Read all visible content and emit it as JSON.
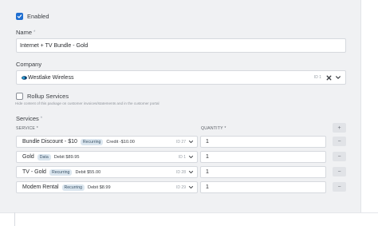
{
  "enabled": {
    "label": "Enabled",
    "checked": true
  },
  "name": {
    "label": "Name",
    "required_mark": "*",
    "value": "Internet + TV Bundle - Gold"
  },
  "company": {
    "label": "Company",
    "value": "Westlake Wireless",
    "id_text": "ID 1"
  },
  "rollup": {
    "label": "Rollup Services",
    "checked": false,
    "help": "Hide content of this package on customer invoices/statements and in the customer portal"
  },
  "services": {
    "label": "Services",
    "required_mark": "*",
    "col_service": "SERVICE",
    "col_quantity": "QUANTITY",
    "col_mark": "*",
    "add_label": "+",
    "rows": [
      {
        "name": "Bundle Discount - $10",
        "badge": "Recurring",
        "amount_label": "Credit -$10.00",
        "id_text": "ID 27",
        "quantity": "1",
        "remove_label": "−"
      },
      {
        "name": "Gold",
        "badge": "Data",
        "amount_label": "Debit $89.95",
        "id_text": "ID 1",
        "quantity": "1",
        "remove_label": "−"
      },
      {
        "name": "TV - Gold",
        "badge": "Recurring",
        "amount_label": "Debit $55.00",
        "id_text": "ID 28",
        "quantity": "1",
        "remove_label": "−"
      },
      {
        "name": "Modem Rental",
        "badge": "Recurring",
        "amount_label": "Debit $8.99",
        "id_text": "ID 29",
        "quantity": "1",
        "remove_label": "−"
      }
    ]
  },
  "colors": {
    "accent": "#1f6fd1",
    "panel_bg": "#f0f1f3",
    "badge_bg": "#dbe6ef"
  },
  "icons": [
    "check-icon",
    "company-logo-icon",
    "chevron-down-icon",
    "clear-icon",
    "plus-icon",
    "minus-icon"
  ]
}
